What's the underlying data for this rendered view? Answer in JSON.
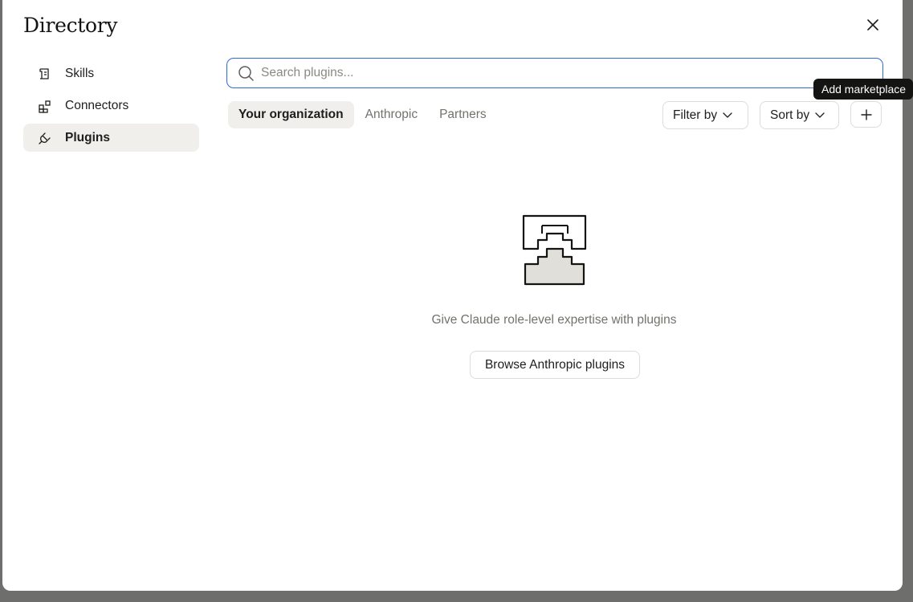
{
  "dialog": {
    "title": "Directory"
  },
  "sidebar": {
    "items": [
      {
        "label": "Skills",
        "icon": "skills-icon",
        "active": false
      },
      {
        "label": "Connectors",
        "icon": "connectors-icon",
        "active": false
      },
      {
        "label": "Plugins",
        "icon": "plug-icon",
        "active": true
      }
    ]
  },
  "search": {
    "placeholder": "Search plugins...",
    "value": ""
  },
  "tabs": [
    {
      "label": "Your organization",
      "active": true
    },
    {
      "label": "Anthropic",
      "active": false
    },
    {
      "label": "Partners",
      "active": false
    }
  ],
  "toolbar": {
    "filter_label": "Filter by",
    "sort_label": "Sort by",
    "add_tooltip": "Add marketplace"
  },
  "empty_state": {
    "message": "Give Claude role-level expertise with plugins",
    "button_label": "Browse Anthropic plugins"
  },
  "colors": {
    "accent_focus": "#2c6bd8",
    "active_bg": "#f0efeb",
    "muted_text": "#73726c"
  }
}
